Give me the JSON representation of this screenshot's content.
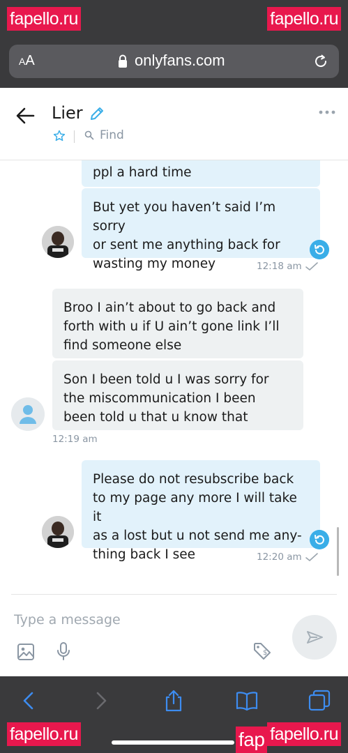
{
  "watermarks": {
    "top_left": "fapello.ru",
    "top_right": "fapello.ru",
    "bottom_left": "fapello.ru",
    "bottom_right": "fapello.ru",
    "bottom_mid": "fap"
  },
  "browser": {
    "aa_label_small": "A",
    "aa_label_big": "A",
    "url": "onlyfans.com"
  },
  "header": {
    "title": "Lier",
    "find_label": "Find"
  },
  "messages": [
    {
      "dir": "out",
      "text": "ppl a hard time"
    },
    {
      "dir": "out",
      "text": "But yet you haven’t said I’m sorry\nor sent me anything back for\nwasting my money",
      "time": "12:18 am"
    },
    {
      "dir": "in",
      "text": "Broo I ain’t about to go back and\nforth with u if U ain’t gone link I’ll\nfind someone else"
    },
    {
      "dir": "in",
      "text": "Son I been told u I was sorry for\nthe miscommunication I been\nbeen told u that u know that",
      "time": "12:19 am"
    },
    {
      "dir": "out",
      "text": "Please do not resubscribe back\nto my page any more I will take it\nas a lost but u not send me any-\nthing back I see",
      "time": "12:20 am"
    }
  ],
  "composer": {
    "placeholder": "Type a message"
  },
  "colors": {
    "accent": "#3aaee8",
    "out_bubble": "#e2f2fb",
    "in_bubble": "#eef1f2",
    "browser_chrome": "#3a3a3c",
    "watermark": "#e8184d"
  }
}
